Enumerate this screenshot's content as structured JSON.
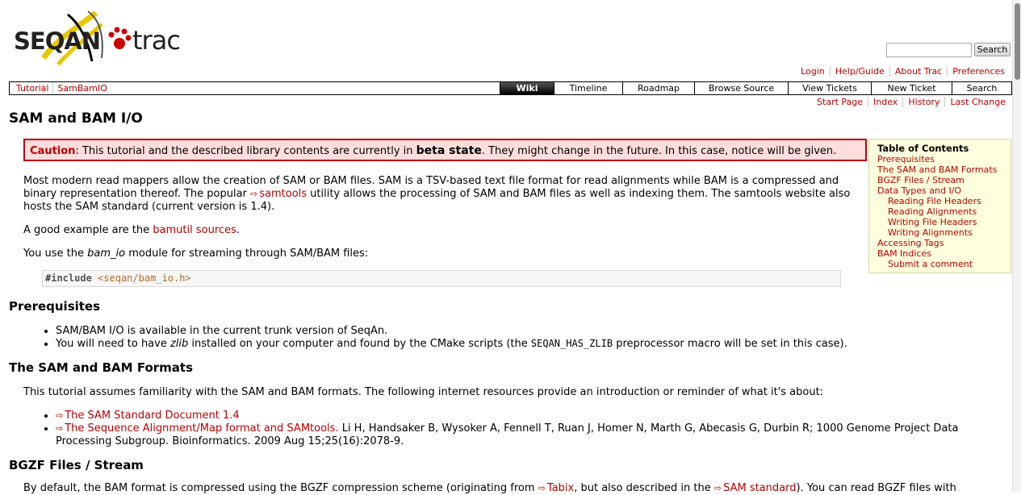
{
  "logo": {
    "seqan": "SEQAN",
    "trac": "trac"
  },
  "search": {
    "placeholder": "",
    "button": "Search"
  },
  "metanav": [
    "Login",
    "Help/Guide",
    "About Trac",
    "Preferences"
  ],
  "breadcrumbs": [
    "Tutorial",
    "SamBamIO"
  ],
  "mainnav": [
    {
      "label": "Wiki",
      "active": true
    },
    {
      "label": "Timeline"
    },
    {
      "label": "Roadmap"
    },
    {
      "label": "Browse Source"
    },
    {
      "label": "View Tickets"
    },
    {
      "label": "New Ticket"
    },
    {
      "label": "Search"
    }
  ],
  "ctxtnav": [
    "Start Page",
    "Index",
    "History",
    "Last Change"
  ],
  "page_title": "SAM and BAM I/O",
  "caution": {
    "label": "Caution",
    "text1": ": This tutorial and the described library contents are currently in ",
    "bold": "beta state",
    "text2": ". They might change in the future. In this case, notice will be given."
  },
  "toc": {
    "title": "Table of Contents",
    "items": [
      {
        "label": "Prerequisites",
        "level": 1
      },
      {
        "label": "The SAM and BAM Formats",
        "level": 1
      },
      {
        "label": "BGZF Files / Stream",
        "level": 1
      },
      {
        "label": "Data Types and I/O",
        "level": 1
      },
      {
        "label": "Reading File Headers",
        "level": 2
      },
      {
        "label": "Reading Alignments",
        "level": 2
      },
      {
        "label": "Writing File Headers",
        "level": 2
      },
      {
        "label": "Writing Alignments",
        "level": 2
      },
      {
        "label": "Accessing Tags",
        "level": 1
      },
      {
        "label": "BAM Indices",
        "level": 1
      },
      {
        "label": "Submit a comment",
        "level": 2
      }
    ]
  },
  "intro": {
    "p1a": "Most modern read mappers allow the creation of SAM or BAM files. SAM is a TSV-based text file format for read alignments while BAM is a compressed and binary representation thereof. The popular ",
    "p1link": "samtools",
    "p1b": " utility allows the processing of SAM and BAM files as well as indexing them. The samtools website also hosts the SAM standard (current version is 1.4).",
    "p2a": "A good example are the ",
    "p2link": "bamutil sources",
    "p2b": ".",
    "p3a": "You use the ",
    "p3em": "bam_io",
    "p3b": " module for streaming through SAM/BAM files:"
  },
  "code": {
    "hash": "#",
    "keyword": "include",
    "header": "<seqan/bam_io.h>"
  },
  "prereq": {
    "heading": "Prerequisites",
    "item1": "SAM/BAM I/O is available in the current trunk version of SeqAn.",
    "item2a": "You will need to have ",
    "item2em": "zlib",
    "item2b": " installed on your computer and found by the CMake scripts (the ",
    "item2code": "SEQAN_HAS_ZLIB",
    "item2c": " preprocessor macro will be set in this case)."
  },
  "formats": {
    "heading": "The SAM and BAM Formats",
    "intro": "This tutorial assumes familiarity with the SAM and BAM formats. The following internet resources provide an introduction or reminder of what it's about:",
    "link1": "The SAM Standard Document 1.4",
    "link2": "The Sequence Alignment/Map format and SAMtools.",
    "ref2": " Li H, Handsaker B, Wysoker A, Fennell T, Ruan J, Homer N, Marth G, Abecasis G, Durbin R; 1000 Genome Project Data Processing Subgroup. Bioinformatics. 2009 Aug 15;25(16):2078-9."
  },
  "bgzf": {
    "heading": "BGZF Files / Stream",
    "text1": "By default, the BAM format is compressed using the BGZF compression scheme (originating from ",
    "link1": "Tabix",
    "text2": ", but also described in the ",
    "link2": "SAM standard",
    "text3": "). You can read BGZF files with"
  },
  "colors": {
    "link": "#bb0000",
    "caution_bg": "#ffdddd",
    "toc_bg": "#ffffdd"
  }
}
